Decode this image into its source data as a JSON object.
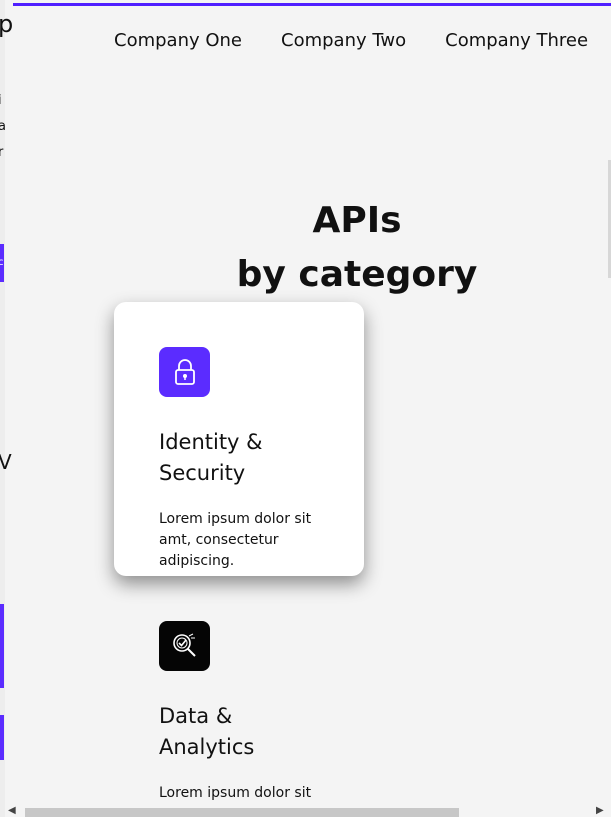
{
  "companies": [
    "Company One",
    "Company Two",
    "Company Three"
  ],
  "section": {
    "title_line1": "APIs",
    "title_line2": "by category"
  },
  "cards": [
    {
      "title_line1": "Identity &",
      "title_line2": "Security",
      "description": "Lorem ipsum dolor sit amt, consectetur adipiscing.",
      "icon": "lock-icon",
      "icon_bg": "#5b2cff",
      "active": true
    },
    {
      "title_line1": "Data &",
      "title_line2": "Analytics",
      "description": "Lorem ipsum dolor sit amt,",
      "icon": "analytics-search-icon",
      "icon_bg": "#050505",
      "active": false
    }
  ],
  "edge_text": {
    "glyph_1": "p",
    "glyph_2": "i",
    "glyph_3": "a",
    "glyph_4": "r",
    "glyph_5": "c",
    "glyph_6": "V"
  },
  "colors": {
    "accent": "#4f1fff",
    "background": "#f4f4f4",
    "card": "#ffffff"
  }
}
